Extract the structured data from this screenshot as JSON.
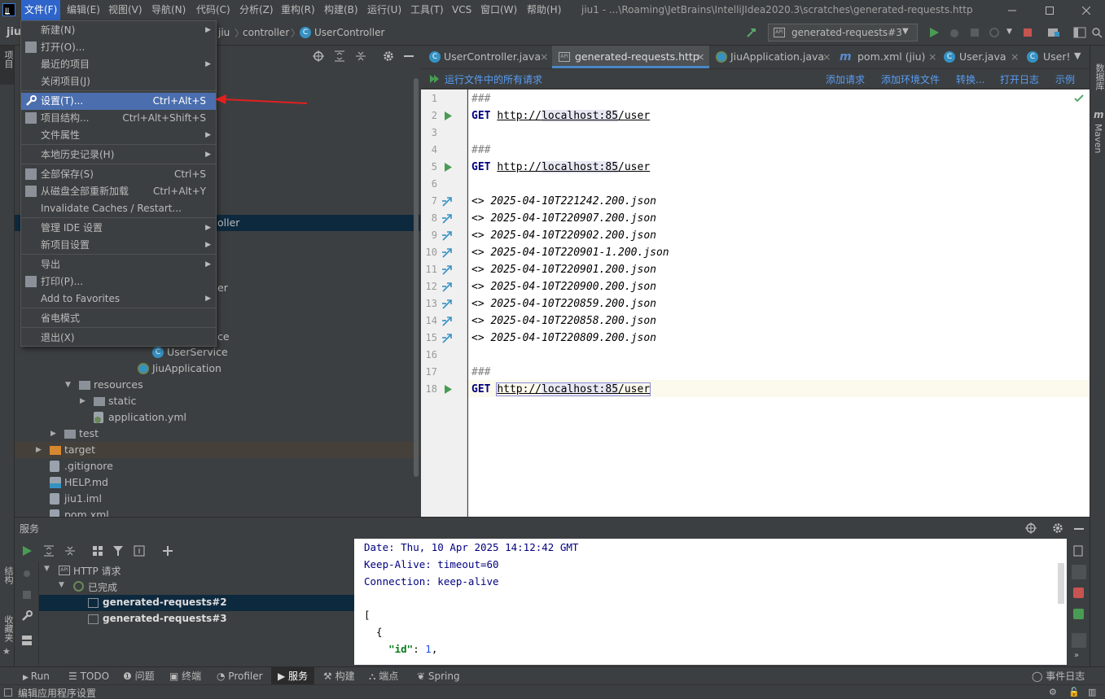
{
  "menubar": {
    "items": [
      "文件(F)",
      "编辑(E)",
      "视图(V)",
      "导航(N)",
      "代码(C)",
      "分析(Z)",
      "重构(R)",
      "构建(B)",
      "运行(U)",
      "工具(T)",
      "VCS",
      "窗口(W)",
      "帮助(H)"
    ],
    "window_title": "jiu1 - ...\\Roaming\\JetBrains\\IntelliJIdea2020.3\\scratches\\generated-requests.http"
  },
  "navbar": {
    "project": "jiu",
    "crumbs": [
      "jiu",
      "controller",
      "UserController"
    ],
    "run_config": "generated-requests#3"
  },
  "left_stripe": {
    "project_label": "项目",
    "structure_label": "结构",
    "favorites_label": "收藏夹"
  },
  "right_stripe": {
    "database_label": "数据库",
    "maven_label": "Maven"
  },
  "file_menu": {
    "items": [
      {
        "label": "新建(N)",
        "shortcut": "",
        "submenu": true
      },
      {
        "label": "打开(O)...",
        "shortcut": "",
        "submenu": false
      },
      {
        "label": "最近的项目",
        "shortcut": "",
        "submenu": true
      },
      {
        "label": "关闭项目(J)",
        "shortcut": "",
        "submenu": false
      },
      {
        "label": "设置(T)...",
        "shortcut": "Ctrl+Alt+S",
        "submenu": false
      },
      {
        "label": "项目结构...",
        "shortcut": "Ctrl+Alt+Shift+S",
        "submenu": false
      },
      {
        "label": "文件属性",
        "shortcut": "",
        "submenu": true
      },
      {
        "label": "本地历史记录(H)",
        "shortcut": "",
        "submenu": true
      },
      {
        "label": "全部保存(S)",
        "shortcut": "Ctrl+S",
        "submenu": false
      },
      {
        "label": "从磁盘全部重新加载",
        "shortcut": "Ctrl+Alt+Y",
        "submenu": false
      },
      {
        "label": "Invalidate Caches / Restart...",
        "shortcut": "",
        "submenu": false
      },
      {
        "label": "管理 IDE 设置",
        "shortcut": "",
        "submenu": true
      },
      {
        "label": "新项目设置",
        "shortcut": "",
        "submenu": true
      },
      {
        "label": "导出",
        "shortcut": "",
        "submenu": true
      },
      {
        "label": "打印(P)...",
        "shortcut": "",
        "submenu": false
      },
      {
        "label": "Add to Favorites",
        "shortcut": "",
        "submenu": true
      },
      {
        "label": "省电模式",
        "shortcut": "",
        "submenu": false
      },
      {
        "label": "退出(X)",
        "shortcut": "",
        "submenu": false
      }
    ]
  },
  "project_tree": {
    "partial_rows": [
      "oller",
      "er",
      "ce"
    ],
    "rows": [
      {
        "label": "UserService",
        "kind": "class"
      },
      {
        "label": "JiuApplication",
        "kind": "spring"
      },
      {
        "label": "resources",
        "kind": "folder"
      },
      {
        "label": "static",
        "kind": "folder"
      },
      {
        "label": "application.yml",
        "kind": "yml"
      },
      {
        "label": "test",
        "kind": "folder"
      },
      {
        "label": "target",
        "kind": "folder-orange"
      },
      {
        "label": ".gitignore",
        "kind": "file"
      },
      {
        "label": "HELP.md",
        "kind": "md"
      },
      {
        "label": "jiu1.iml",
        "kind": "file"
      },
      {
        "label": "pom.xml",
        "kind": "maven"
      }
    ]
  },
  "editor": {
    "tabs": [
      {
        "label": "UserController.java",
        "active": false
      },
      {
        "label": "generated-requests.http",
        "active": true
      },
      {
        "label": "JiuApplication.java",
        "active": false
      },
      {
        "label": "pom.xml (jiu)",
        "active": false
      },
      {
        "label": "User.java",
        "active": false
      },
      {
        "label": "User!",
        "active": false
      }
    ],
    "http_toolbar": {
      "run_all": "运行文件中的所有请求",
      "add_request": "添加请求",
      "add_env": "添加环境文件",
      "convert": "转换...",
      "open_log": "打开日志",
      "examples": "示例"
    },
    "lines": [
      {
        "n": "1",
        "text": "###"
      },
      {
        "n": "2",
        "method": "GET",
        "proto": "http://",
        "host": "localhost:85",
        "path": "/user"
      },
      {
        "n": "3",
        "text": ""
      },
      {
        "n": "4",
        "text": "###"
      },
      {
        "n": "5",
        "method": "GET",
        "proto": "http://",
        "host": "localhost:85",
        "path": "/user"
      },
      {
        "n": "6",
        "text": ""
      },
      {
        "n": "7",
        "resp": "<> 2025-04-10T221242.200.json"
      },
      {
        "n": "8",
        "resp": "<> 2025-04-10T220907.200.json"
      },
      {
        "n": "9",
        "resp": "<> 2025-04-10T220902.200.json"
      },
      {
        "n": "10",
        "resp": "<> 2025-04-10T220901-1.200.json"
      },
      {
        "n": "11",
        "resp": "<> 2025-04-10T220901.200.json"
      },
      {
        "n": "12",
        "resp": "<> 2025-04-10T220900.200.json"
      },
      {
        "n": "13",
        "resp": "<> 2025-04-10T220859.200.json"
      },
      {
        "n": "14",
        "resp": "<> 2025-04-10T220858.200.json"
      },
      {
        "n": "15",
        "resp": "<> 2025-04-10T220809.200.json"
      },
      {
        "n": "16",
        "text": ""
      },
      {
        "n": "17",
        "text": "###"
      },
      {
        "n": "18",
        "method": "GET",
        "proto": "http://",
        "host": "localhost:85",
        "path": "/user"
      }
    ]
  },
  "services": {
    "title": "服务",
    "tree": [
      "HTTP 请求",
      "已完成",
      "generated-requests#2",
      "generated-requests#3"
    ],
    "output": [
      "Date: Thu, 10 Apr 2025 14:12:42 GMT",
      "Keep-Alive: timeout=60",
      "Connection: keep-alive",
      "",
      "[",
      "  {",
      "    \"id\": 1,"
    ]
  },
  "bottom_tabs": [
    "Run",
    "TODO",
    "问题",
    "终端",
    "Profiler",
    "服务",
    "构建",
    "端点",
    "Spring"
  ],
  "event_log": "事件日志",
  "status_text": "编辑应用程序设置"
}
